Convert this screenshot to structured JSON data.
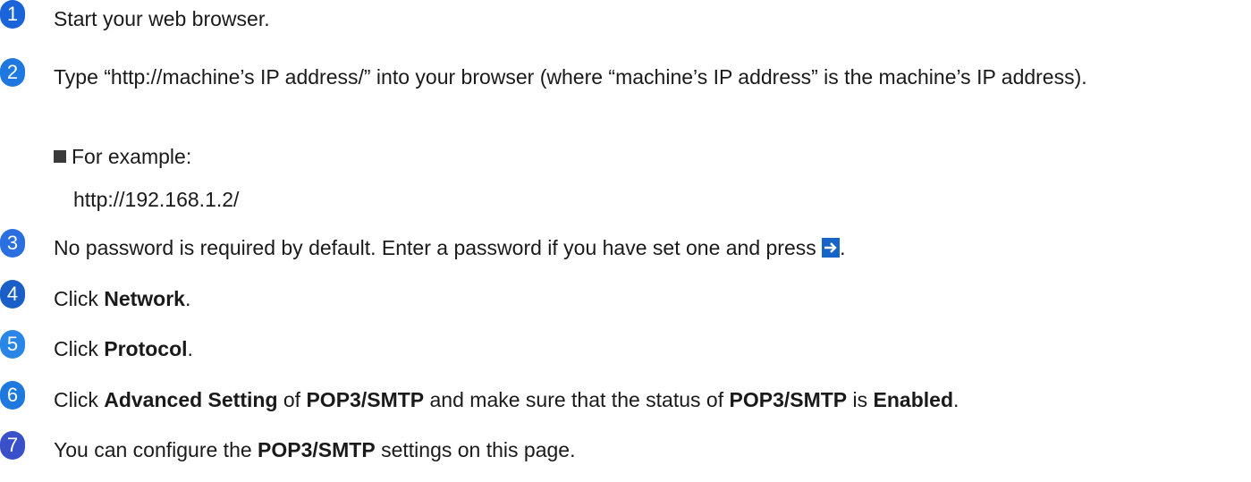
{
  "colors": {
    "step1": "#1a63d8",
    "step2": "#1e78e0",
    "step3": "#2a6fe0",
    "step4": "#1a5fc8",
    "step5": "#2a86e6",
    "step6": "#1f78dd",
    "step7": "#3a50c8",
    "go_button": "#1664c8"
  },
  "steps": [
    {
      "num": "1",
      "text": "Start your web browser."
    },
    {
      "num": "2",
      "text_line": "Type “http://machine’s IP address/” into your browser (where “machine’s IP address” is the machine’s IP address)."
    },
    {
      "num": "3",
      "text": "No password is required by default. Enter a password if you have set one and press ",
      "icon": "go-arrow-icon",
      "end": "."
    },
    {
      "num": "4",
      "pre": "Click ",
      "bold": "Network",
      "post": "."
    },
    {
      "num": "5",
      "pre": "Click ",
      "bold": "Protocol",
      "post": "."
    },
    {
      "num": "6",
      "pre": "Click ",
      "bold1": "Advanced Setting",
      "mid1": " of ",
      "bold2": "POP3/SMTP",
      "mid2": " and make sure that the status of ",
      "bold3": "POP3/SMTP",
      "mid3": " is ",
      "bold4": "Enabled",
      "post": "."
    },
    {
      "num": "7",
      "pre": "You can configure the ",
      "bold": "POP3/SMTP",
      "post": " settings on this page."
    }
  ],
  "example": {
    "label": "For example:",
    "url": "http://192.168.1.2/"
  }
}
